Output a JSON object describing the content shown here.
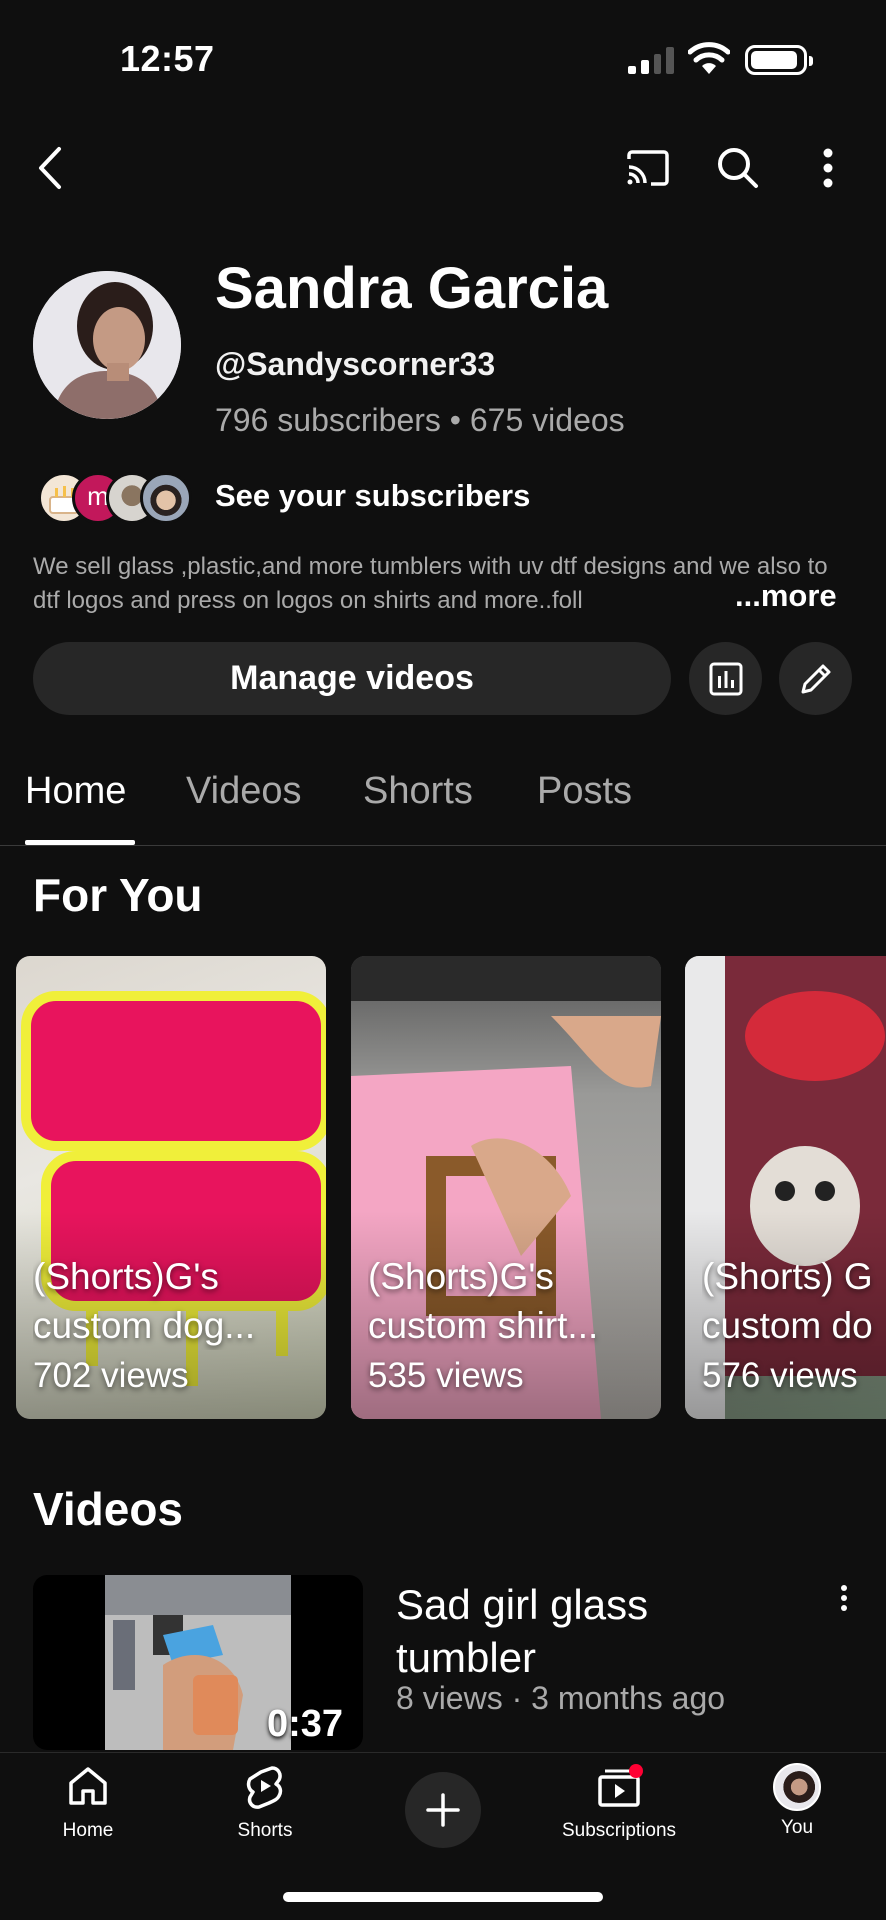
{
  "status_bar": {
    "time": "12:57"
  },
  "top_bar": {
    "icons": [
      "back-arrow-icon",
      "cast-icon",
      "search-icon",
      "more-vert-icon"
    ]
  },
  "channel": {
    "name": "Sandra Garcia",
    "handle": "@Sandyscorner33",
    "stats": "796 subscribers • 675 videos",
    "subscriber_initial": "m",
    "see_subscribers": "See your subscribers",
    "description": "We sell glass ,plastic,and more tumblers with uv dtf designs and we also to dtf logos and press on logos on shirts and more..foll",
    "more_label": "...more",
    "manage_videos": "Manage videos"
  },
  "tabs": [
    {
      "label": "Home",
      "active": true
    },
    {
      "label": "Videos",
      "active": false
    },
    {
      "label": "Shorts",
      "active": false
    },
    {
      "label": "Posts",
      "active": false
    }
  ],
  "for_you": {
    "title": "For You",
    "shorts": [
      {
        "title": "(Shorts)G's\ncustom dog...",
        "views": "702 views"
      },
      {
        "title": "(Shorts)G's\ncustom shirt...",
        "views": "535 views"
      },
      {
        "title": "(Shorts) G\ncustom do",
        "views": "576 views"
      }
    ]
  },
  "videos": {
    "title": "Videos",
    "items": [
      {
        "title": "Sad girl glass tumbler",
        "meta": "8 views · 3 months ago",
        "duration": "0:37"
      }
    ]
  },
  "bottom_nav": {
    "items": [
      {
        "label": "Home",
        "icon": "home-icon"
      },
      {
        "label": "Shorts",
        "icon": "shorts-icon"
      },
      {
        "label": "Subscriptions",
        "icon": "subscriptions-icon"
      },
      {
        "label": "You",
        "icon": "avatar"
      }
    ]
  },
  "colors": {
    "background": "#0f0f0f",
    "surface": "#272727",
    "secondary_text": "#aaaaaa",
    "notification": "#ff0033"
  }
}
